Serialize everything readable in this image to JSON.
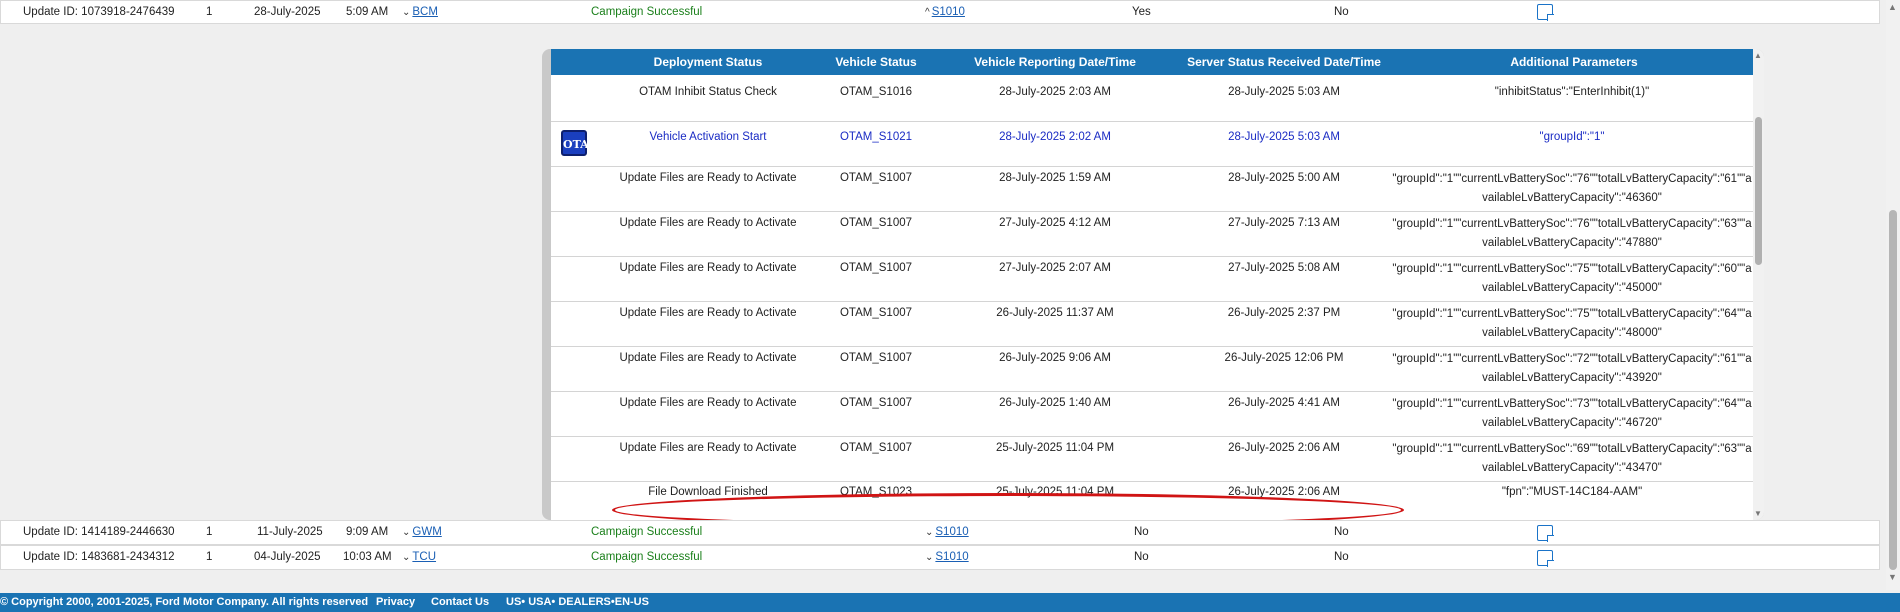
{
  "top_row": {
    "update_id": "Update ID: 1073918-2476439",
    "count": "1",
    "date": "28-July-2025",
    "time": "5:09 AM",
    "module": "BCM",
    "status": "Campaign Successful",
    "code": "S1010",
    "flag1": "Yes",
    "flag2": "No"
  },
  "panel": {
    "headers": [
      "Deployment Status",
      "Vehicle Status",
      "Vehicle Reporting Date/Time",
      "Server Status Received Date/Time",
      "Additional Parameters"
    ],
    "rows": [
      {
        "deployment": "OTAM Inhibit Status Check",
        "vehicle_status": "OTAM_S1016",
        "reported": "28-July-2025 2:03 AM",
        "received": "28-July-2025 5:03 AM",
        "params": "\"inhibitStatus\":\"EnterInhibit(1)\""
      },
      {
        "deployment": "Vehicle Activation Start",
        "vehicle_status": "OTAM_S1021",
        "reported": "28-July-2025 2:02 AM",
        "received": "28-July-2025 5:03 AM",
        "params": "\"groupId\":\"1\"",
        "badge": "OTA"
      },
      {
        "deployment": "Update Files are Ready to Activate",
        "vehicle_status": "OTAM_S1007",
        "reported": "28-July-2025 1:59 AM",
        "received": "28-July-2025 5:00 AM",
        "params": "\"groupId\":\"1\"\"currentLvBatterySoc\":\"76\"\"totalLvBatteryCapacity\":\"61\"\"availableLvBatteryCapacity\":\"46360\""
      },
      {
        "deployment": "Update Files are Ready to Activate",
        "vehicle_status": "OTAM_S1007",
        "reported": "27-July-2025 4:12 AM",
        "received": "27-July-2025 7:13 AM",
        "params": "\"groupId\":\"1\"\"currentLvBatterySoc\":\"76\"\"totalLvBatteryCapacity\":\"63\"\"availableLvBatteryCapacity\":\"47880\""
      },
      {
        "deployment": "Update Files are Ready to Activate",
        "vehicle_status": "OTAM_S1007",
        "reported": "27-July-2025 2:07 AM",
        "received": "27-July-2025 5:08 AM",
        "params": "\"groupId\":\"1\"\"currentLvBatterySoc\":\"75\"\"totalLvBatteryCapacity\":\"60\"\"availableLvBatteryCapacity\":\"45000\""
      },
      {
        "deployment": "Update Files are Ready to Activate",
        "vehicle_status": "OTAM_S1007",
        "reported": "26-July-2025 11:37 AM",
        "received": "26-July-2025 2:37 PM",
        "params": "\"groupId\":\"1\"\"currentLvBatterySoc\":\"75\"\"totalLvBatteryCapacity\":\"64\"\"availableLvBatteryCapacity\":\"48000\""
      },
      {
        "deployment": "Update Files are Ready to Activate",
        "vehicle_status": "OTAM_S1007",
        "reported": "26-July-2025 9:06 AM",
        "received": "26-July-2025 12:06 PM",
        "params": "\"groupId\":\"1\"\"currentLvBatterySoc\":\"72\"\"totalLvBatteryCapacity\":\"61\"\"availableLvBatteryCapacity\":\"43920\""
      },
      {
        "deployment": "Update Files are Ready to Activate",
        "vehicle_status": "OTAM_S1007",
        "reported": "26-July-2025 1:40 AM",
        "received": "26-July-2025 4:41 AM",
        "params": "\"groupId\":\"1\"\"currentLvBatterySoc\":\"73\"\"totalLvBatteryCapacity\":\"64\"\"availableLvBatteryCapacity\":\"46720\""
      },
      {
        "deployment": "Update Files are Ready to Activate",
        "vehicle_status": "OTAM_S1007",
        "reported": "25-July-2025 11:04 PM",
        "received": "26-July-2025 2:06 AM",
        "params": "\"groupId\":\"1\"\"currentLvBatterySoc\":\"69\"\"totalLvBatteryCapacity\":\"63\"\"availableLvBatteryCapacity\":\"43470\""
      },
      {
        "deployment": "File Download Finished",
        "vehicle_status": "OTAM_S1023",
        "reported": "25-July-2025 11:04 PM",
        "received": "26-July-2025 2:06 AM",
        "params": "\"fpn\":\"MUST-14C184-AAM\""
      }
    ]
  },
  "bottom_rows": [
    {
      "update_id": "Update ID: 1414189-2446630",
      "count": "1",
      "date": "11-July-2025",
      "time": "9:09 AM",
      "module": "GWM",
      "status": "Campaign Successful",
      "code": "S1010",
      "flag1": "No",
      "flag2": "No"
    },
    {
      "update_id": "Update ID: 1483681-2434312",
      "count": "1",
      "date": "04-July-2025",
      "time": "10:03 AM",
      "module": "TCU",
      "status": "Campaign Successful",
      "code": "S1010",
      "flag1": "No",
      "flag2": "No"
    }
  ],
  "footer": {
    "copyright": "© Copyright 2000, 2001-2025, Ford Motor Company. All rights reserved",
    "privacy": "Privacy",
    "contact": "Contact Us",
    "locale": "US• USA• DEALERS•EN-US"
  },
  "colors": {
    "header_blue": "#1a73b3",
    "success_green": "#1a7f1a",
    "highlight_red": "#d01414",
    "active_row_blue": "#1a2bc4"
  }
}
